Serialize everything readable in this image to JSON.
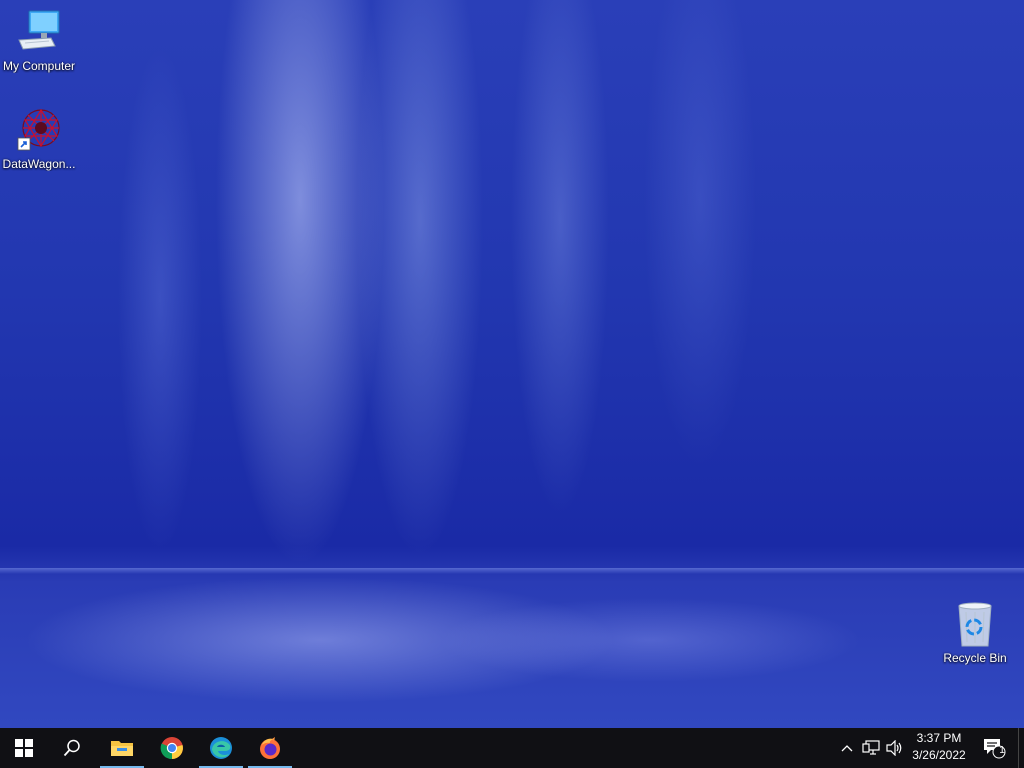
{
  "desktop": {
    "icons": [
      {
        "label": "My Computer",
        "icon": "computer-icon"
      },
      {
        "label": "DataWagon...",
        "icon": "datawagon-icon"
      },
      {
        "label": "Recycle Bin",
        "icon": "recycle-bin-icon"
      }
    ]
  },
  "taskbar": {
    "start": {
      "icon": "windows-logo-icon"
    },
    "search": {
      "icon": "search-icon"
    },
    "pinned": [
      {
        "name": "File Explorer",
        "icon": "file-explorer-icon",
        "active": true
      },
      {
        "name": "Google Chrome",
        "icon": "chrome-icon",
        "active": false
      },
      {
        "name": "Microsoft Edge",
        "icon": "edge-icon",
        "active": true
      },
      {
        "name": "Firefox",
        "icon": "firefox-icon",
        "active": true
      }
    ],
    "tray": {
      "icons": [
        "chevron-up-icon",
        "network-icon",
        "volume-icon"
      ],
      "time": "3:37 PM",
      "date": "3/26/2022",
      "notification_count": "1"
    }
  },
  "colors": {
    "taskbar_bg": "#101014",
    "active_indicator": "#76b9ed",
    "wallpaper_base": "#2237b0"
  }
}
